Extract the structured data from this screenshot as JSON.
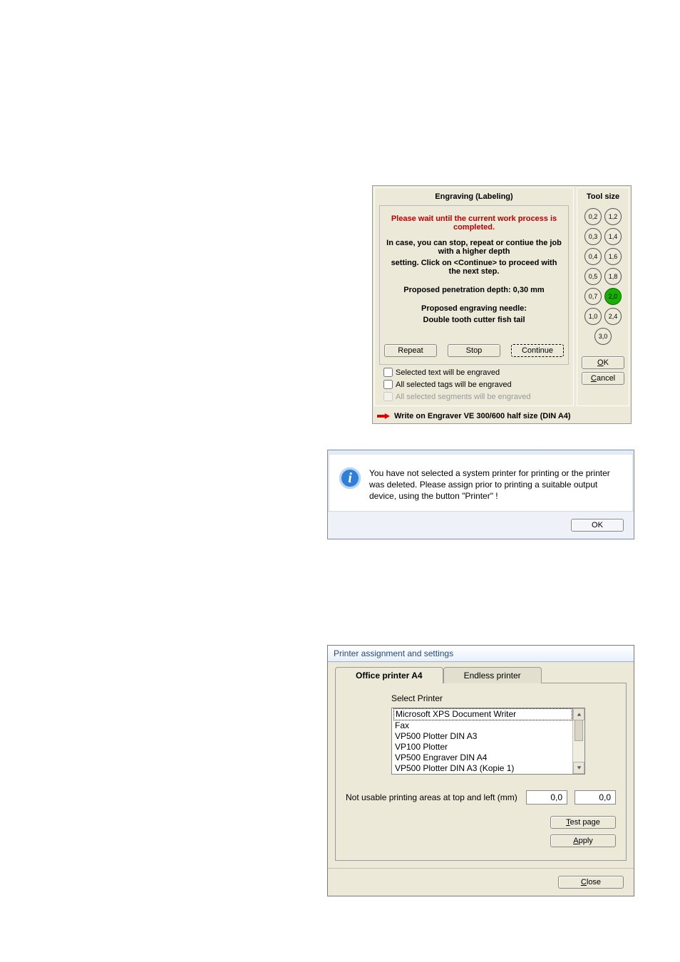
{
  "engrave": {
    "title": "Engraving (Labeling)",
    "warn": "Please wait until the current work process is completed.",
    "line1": "In case, you can stop, repeat or contiue the job with a higher depth",
    "line2": "setting. Click on <Continue> to proceed with the next step.",
    "depth": "Proposed penetration depth: 0,30 mm",
    "needle": "Proposed engraving needle:",
    "needle_val": "Double tooth cutter fish tail",
    "repeat": "Repeat",
    "stop": "Stop",
    "cont": "Continue",
    "chk1": "Selected text will be engraved",
    "chk2": "All selected tags will be engraved",
    "chk3": "All selected segments will be engraved",
    "toolsize": "Tool size",
    "tools": [
      [
        "0,2",
        "1,2"
      ],
      [
        "0,3",
        "1,4"
      ],
      [
        "0,4",
        "1,6"
      ],
      [
        "0,5",
        "1,8"
      ],
      [
        "0,7",
        "2,0"
      ],
      [
        "1,0",
        "2,4"
      ],
      [
        "3,0"
      ]
    ],
    "tool_selected": "2,0",
    "ok": "OK",
    "cancel": "Cancel",
    "footer": "Write on Engraver VE 300/600 half size (DIN A4)"
  },
  "info": {
    "text": "You have not selected a system printer for printing or the printer was deleted. Please assign prior to printing a suitable output device, using the button \"Printer\" !",
    "ok": "OK"
  },
  "printer": {
    "title": "Printer assignment and settings",
    "tab_office": "Office printer A4",
    "tab_endless": "Endless printer",
    "select_label": "Select Printer",
    "items": [
      "Microsoft XPS Document Writer",
      "Fax",
      "VP500 Plotter DIN A3",
      "VP100 Plotter",
      "VP500 Engraver DIN A4",
      "VP500 Plotter DIN A3 (Kopie 1)"
    ],
    "selected_index": 0,
    "margins_label": "Not usable printing areas at top and left (mm)",
    "margin_top": "0,0",
    "margin_left": "0,0",
    "testpage": "Test page",
    "apply": "Apply",
    "close": "Close"
  }
}
